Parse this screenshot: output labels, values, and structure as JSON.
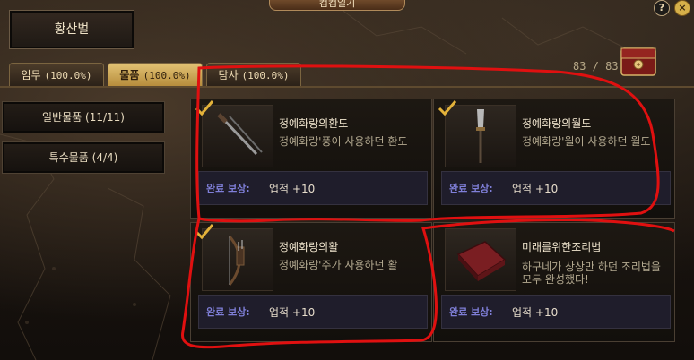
{
  "window": {
    "title": "컴컴일기",
    "help_label": "?",
    "close_label": "×"
  },
  "region": {
    "name": "황산벌"
  },
  "tabs": [
    {
      "label": "임무",
      "percent": "(100.0%)"
    },
    {
      "label": "물품",
      "percent": "(100.0%)"
    },
    {
      "label": "탐사",
      "percent": "(100.0%)"
    }
  ],
  "progress": {
    "count": "83 / 83",
    "icon": "treasure-chest-icon"
  },
  "categories": [
    {
      "label": "일반물품 (11/11)"
    },
    {
      "label": "특수물품 (4/4)"
    }
  ],
  "items": [
    {
      "name": "정예화랑의환도",
      "desc": "정예화랑'풍이 사용하던 환도",
      "reward_label": "완료 보상:",
      "reward_value": "업적 +10",
      "icon": "sword-icon"
    },
    {
      "name": "정예화랑의월도",
      "desc": "정예화랑'월이 사용하던 월도",
      "reward_label": "완료 보상:",
      "reward_value": "업적 +10",
      "icon": "glaive-icon"
    },
    {
      "name": "정예화랑의활",
      "desc": "정예화랑'주가 사용하던 활",
      "reward_label": "완료 보상:",
      "reward_value": "업적 +10",
      "icon": "bow-icon"
    },
    {
      "name": "미래를위한조리법",
      "desc": "하구네가 상상만 하던 조리법을 모두 완성했다!",
      "reward_label": "완료 보상:",
      "reward_value": "업적 +10",
      "icon": "recipe-book-icon"
    }
  ],
  "colors": {
    "accent_gold": "#d6b04a",
    "reward_label": "#7f7fd8",
    "annotation_red": "#e01010"
  }
}
